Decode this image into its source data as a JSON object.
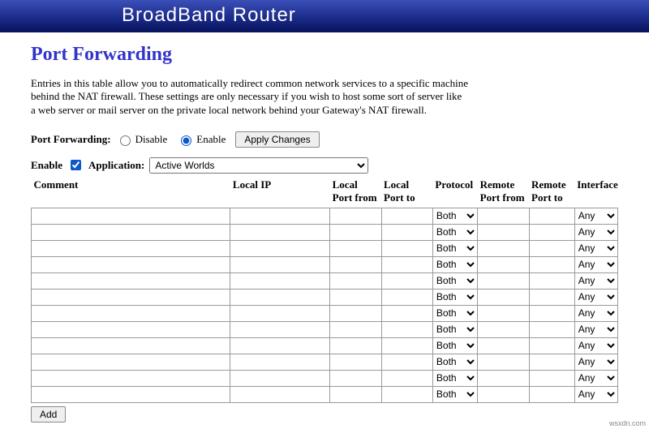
{
  "header": {
    "title": "BroadBand Router"
  },
  "page": {
    "title": "Port Forwarding",
    "description": "Entries in this table allow you to automatically redirect common network services to a specific machine behind the NAT firewall. These settings are only necessary if you wish to host some sort of server like a web server or mail server on the private local network behind your Gateway's NAT firewall."
  },
  "pf_toggle": {
    "label": "Port Forwarding:",
    "disable": "Disable",
    "enable": "Enable",
    "apply": "Apply Changes"
  },
  "app_row": {
    "enable_label": "Enable",
    "application_label": "Application:",
    "selected": "Active Worlds"
  },
  "columns": {
    "comment": "Comment",
    "local_ip": "Local IP",
    "lp_from": "Local Port from",
    "lp_to": "Local Port to",
    "protocol": "Protocol",
    "rp_from": "Remote Port from",
    "rp_to": "Remote Port to",
    "interface": "Interface"
  },
  "defaults": {
    "protocol": "Both",
    "interface": "Any"
  },
  "row_count": 12,
  "buttons": {
    "add": "Add"
  },
  "watermark": "wsxdn.com"
}
